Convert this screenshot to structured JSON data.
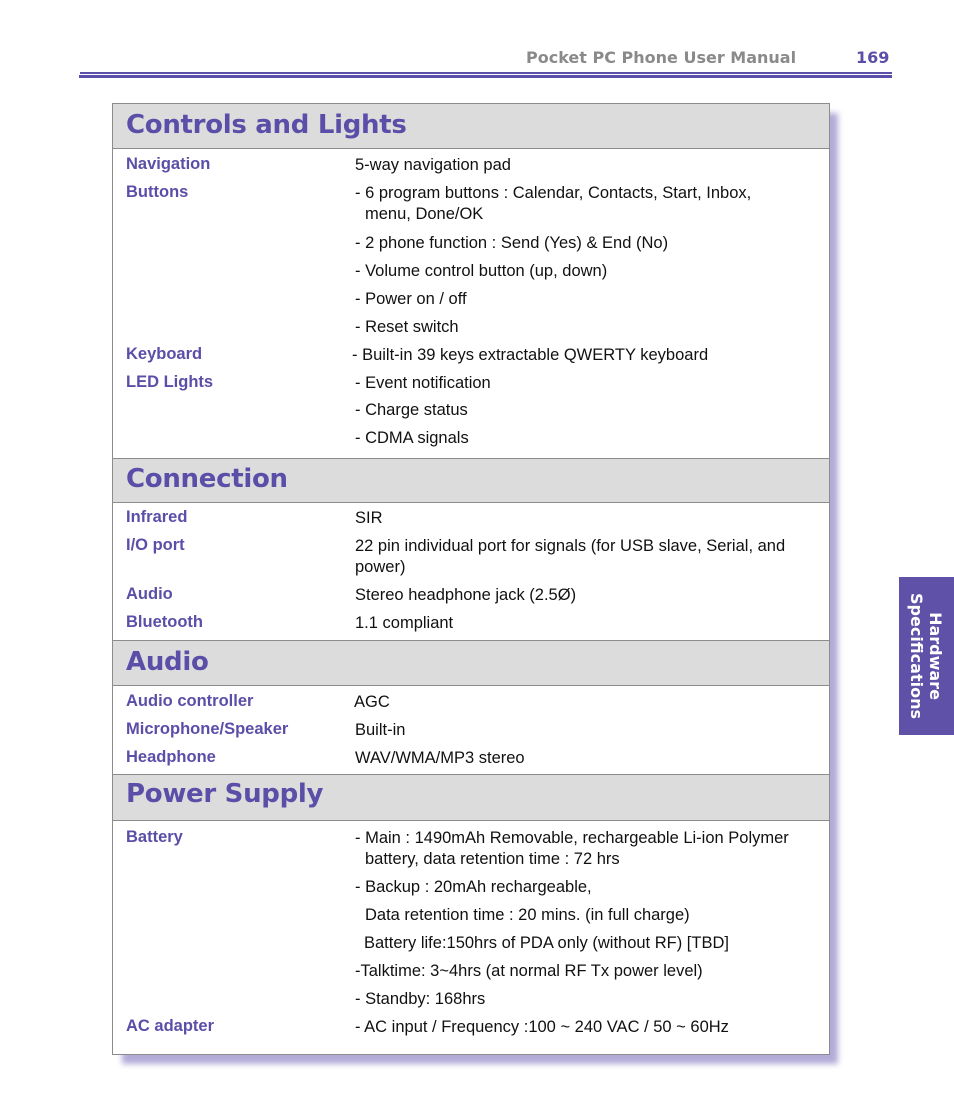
{
  "header": {
    "title": "Pocket PC Phone User Manual",
    "page_number": "169"
  },
  "side_tab": {
    "line1": "Hardware",
    "line2": "Specifications"
  },
  "sections": [
    {
      "title": "Controls and Lights",
      "rows": [
        {
          "label": "Navigation",
          "values": [
            "5-way navigation pad"
          ]
        },
        {
          "label": "Buttons",
          "values": [
            "- 6 program buttons : Calendar, Contacts, Start, Inbox,",
            "menu, Done/OK",
            "- 2 phone function : Send (Yes) & End (No)",
            "- Volume control button (up, down)",
            "- Power on / off",
            "- Reset switch"
          ]
        },
        {
          "label": "Keyboard",
          "values": [
            "- Built-in 39 keys extractable QWERTY keyboard"
          ]
        },
        {
          "label": "LED Lights",
          "values": [
            "- Event notification",
            "- Charge status",
            "- CDMA signals"
          ]
        }
      ]
    },
    {
      "title": "Connection",
      "rows": [
        {
          "label": "Infrared",
          "values": [
            "SIR"
          ]
        },
        {
          "label": "I/O port",
          "values": [
            "22 pin individual port for signals (for USB slave, Serial, and",
            "power)"
          ]
        },
        {
          "label": "Audio",
          "values": [
            "Stereo headphone jack (2.5Ø)"
          ]
        },
        {
          "label": "Bluetooth",
          "values": [
            "1.1 compliant"
          ]
        }
      ]
    },
    {
      "title": "Audio",
      "rows": [
        {
          "label": "Audio controller",
          "values": [
            "AGC"
          ]
        },
        {
          "label": "Microphone/Speaker",
          "values": [
            "Built-in"
          ]
        },
        {
          "label": "Headphone",
          "values": [
            "WAV/WMA/MP3 stereo"
          ]
        }
      ]
    },
    {
      "title": "Power Supply",
      "rows": [
        {
          "label": "Battery",
          "values": [
            "- Main : 1490mAh Removable, rechargeable Li-ion Polymer",
            "battery, data retention time : 72 hrs",
            "- Backup : 20mAh rechargeable,",
            "Data retention time : 20 mins. (in full charge)",
            "Battery life:150hrs of PDA only (without RF) [TBD]",
            "-Talktime: 3~4hrs (at normal RF Tx power level)",
            "- Standby: 168hrs"
          ]
        },
        {
          "label": "AC adapter",
          "values": [
            "- AC input / Frequency :100 ~ 240 VAC / 50 ~ 60Hz"
          ]
        }
      ]
    }
  ]
}
